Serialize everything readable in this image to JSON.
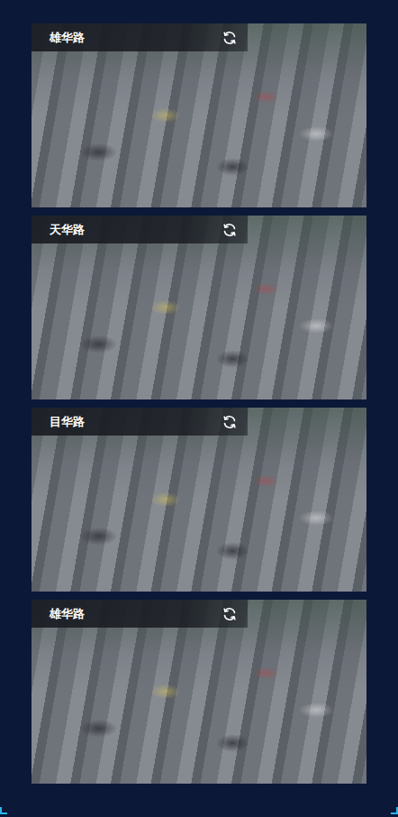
{
  "cameras": [
    {
      "label": "雄华路"
    },
    {
      "label": "天华路"
    },
    {
      "label": "目华路"
    },
    {
      "label": "雄华路"
    }
  ]
}
